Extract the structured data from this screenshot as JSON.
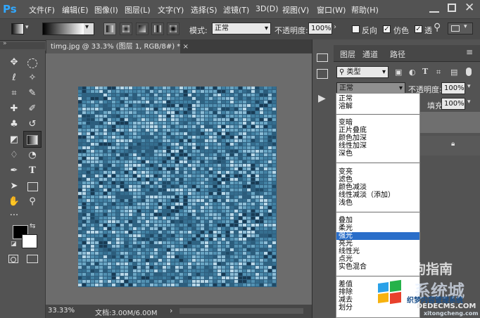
{
  "app": {
    "logo": "Ps"
  },
  "menu": [
    "文件(F)",
    "编辑(E)",
    "图像(I)",
    "图层(L)",
    "文字(Y)",
    "选择(S)",
    "滤镜(T)",
    "3D(D)",
    "视图(V)",
    "窗口(W)",
    "帮助(H)"
  ],
  "options": {
    "mode_label": "模式:",
    "mode_value": "正常",
    "opacity_label": "不透明度:",
    "opacity_value": "100%",
    "reverse_label": "反向",
    "dither_label": "仿色",
    "transparency_label": "透"
  },
  "document": {
    "tab_title": "timg.jpg @ 33.3% (图层 1, RGB/8#) *",
    "zoom": "33.33%",
    "doc_info": "文档:3.00M/6.00M"
  },
  "layers_panel": {
    "tabs": [
      "图层",
      "通道",
      "路径"
    ],
    "filter_label": "类型",
    "blend_value": "正常",
    "opacity_label": "不透明度:",
    "opacity_value": "100%",
    "fill_label": "填充:",
    "fill_value": "100%"
  },
  "blend_modes": {
    "group1": [
      "正常",
      "溶解"
    ],
    "group2": [
      "变暗",
      "正片叠底",
      "颜色加深",
      "线性加深",
      "深色"
    ],
    "group3": [
      "变亮",
      "滤色",
      "颜色减淡",
      "线性减淡（添加）",
      "浅色"
    ],
    "group4": [
      "叠加",
      "柔光",
      "强光",
      "亮光",
      "线性光",
      "点光",
      "实色混合"
    ],
    "group5": [
      "差值",
      "排除",
      "减去",
      "划分"
    ],
    "selected": "强光"
  },
  "watermarks": {
    "sogou": "搜狗指南",
    "xitong": "系统城",
    "xitong_site": "xitongcheng.com",
    "dede_title": "织梦内容管理系统",
    "dede_site": "DEDECMS.COM"
  },
  "colors": {
    "accent": "#31a8ff",
    "selection": "#2a6ec9",
    "canvas_blue": "#3d6f91"
  }
}
